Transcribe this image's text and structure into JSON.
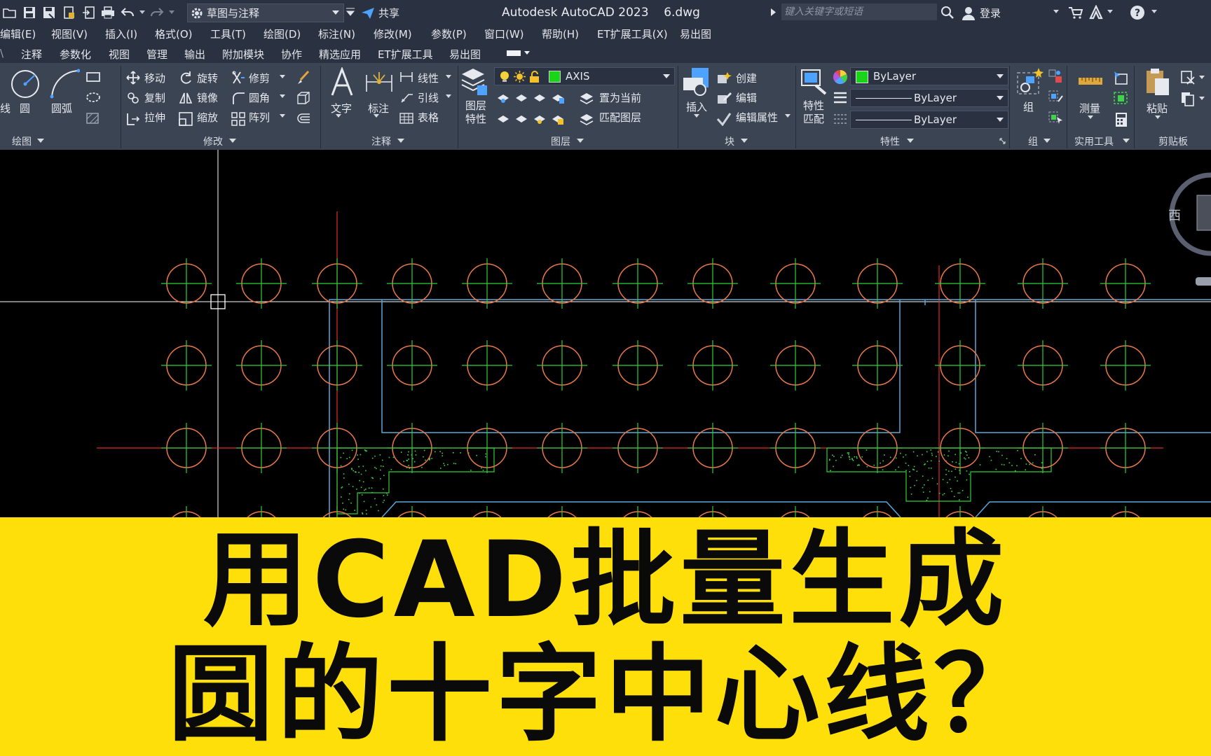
{
  "app": {
    "title": "Autodesk AutoCAD 2023",
    "filename": "6.dwg",
    "workspace": "草图与注释",
    "share_label": "共享",
    "search_placeholder": "键入关键字或短语",
    "login_label": "登录"
  },
  "menu": [
    "编辑(E)",
    "视图(V)",
    "插入(I)",
    "格式(O)",
    "工具(T)",
    "绘图(D)",
    "标注(N)",
    "修改(M)",
    "参数(P)",
    "窗口(W)",
    "帮助(H)",
    "ET扩展工具(X)",
    "易出图"
  ],
  "tabs": [
    "注释",
    "参数化",
    "视图",
    "管理",
    "输出",
    "附加模块",
    "协作",
    "精选应用",
    "ET扩展工具",
    "易出图"
  ],
  "ribbon": {
    "draw": {
      "panel": "绘图",
      "line_fragment": "线",
      "circle": "圆",
      "arc": "圆弧"
    },
    "modify": {
      "panel": "修改",
      "move": "移动",
      "rotate": "旋转",
      "trim": "修剪",
      "copy": "复制",
      "mirror": "镜像",
      "fillet": "圆角",
      "stretch": "拉伸",
      "scale": "缩放",
      "array": "阵列"
    },
    "annotation": {
      "panel": "注释",
      "text": "文字",
      "dimension": "标注",
      "linear": "线性",
      "leader": "引线",
      "table": "表格"
    },
    "layers": {
      "panel": "图层",
      "layer_props": "图层\n特性",
      "current_layer": "AXIS",
      "set_current": "置为当前",
      "match_layer": "匹配图层"
    },
    "block": {
      "panel": "块",
      "insert": "插入",
      "create": "创建",
      "edit": "编辑",
      "edit_attr": "编辑属性"
    },
    "properties": {
      "panel": "特性",
      "match": "特性\n匹配",
      "color": "ByLayer",
      "linetype": "ByLayer",
      "lineweight": "ByLayer"
    },
    "groups": {
      "panel": "组",
      "group": "组"
    },
    "utilities": {
      "panel": "实用工具",
      "measure": "测量"
    },
    "clipboard": {
      "panel": "剪贴板",
      "paste": "粘贴"
    }
  },
  "viewcube": {
    "direction": "西"
  },
  "banner": {
    "line1": "用CAD批量生成",
    "line2": "圆的十字中心线？"
  },
  "colors": {
    "circle": "#e8784a",
    "center_mark": "#2fcf3a",
    "axis": "#e02a2a",
    "outline": "#5aa7d8",
    "hatch": "#3fd34b",
    "banner_bg": "#ffdf0a",
    "layer_color": "#19d419"
  }
}
